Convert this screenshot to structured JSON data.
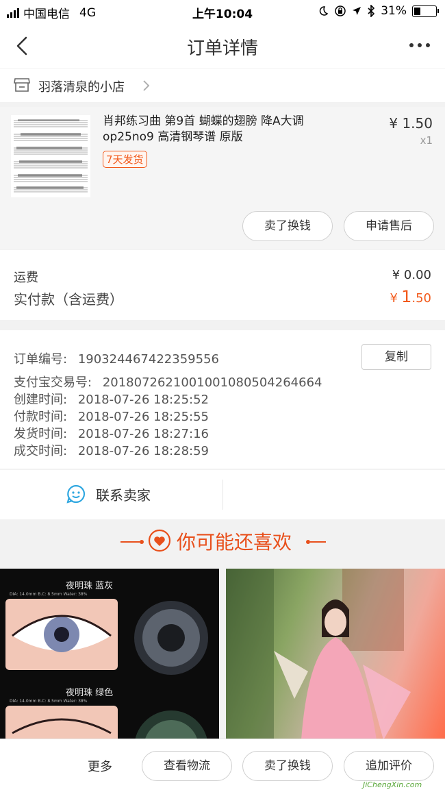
{
  "status_bar": {
    "carrier": "中国电信",
    "network": "4G",
    "time": "上午10:04",
    "battery": "31%",
    "battery_level": 0.31
  },
  "nav": {
    "title": "订单详情"
  },
  "shop": {
    "name": "羽落清泉的小店"
  },
  "product": {
    "title_line1": "肖邦练习曲 第9首 蝴蝶的翅膀 降A大调",
    "title_line2": "op25no9 高清钢琴谱 原版",
    "tag": "7天发货",
    "price": "¥ 1.50",
    "quantity": "x1",
    "sell_button": "卖了换钱",
    "after_sale_button": "申请售后"
  },
  "fees": {
    "shipping_label": "运费",
    "shipping_value": "¥ 0.00",
    "paid_label": "实付款（含运费）",
    "paid_currency": "¥",
    "paid_int": "1",
    "paid_dec": ".50"
  },
  "order_info": {
    "order_no_label": "订单编号:",
    "order_no": "190324467422359556",
    "copy_button": "复制",
    "alipay_label": "支付宝交易号:",
    "alipay_no": "2018072621001001080504264664",
    "created_label": "创建时间:",
    "created": "2018-07-26 18:25:52",
    "paid_label": "付款时间:",
    "paid": "2018-07-26 18:25:55",
    "shipped_label": "发货时间:",
    "shipped": "2018-07-26 18:27:16",
    "done_label": "成交时间:",
    "done": "2018-07-26 18:28:59"
  },
  "contact": {
    "label": "联系卖家"
  },
  "recommend": {
    "heading": "你可能还喜欢",
    "item1": {
      "title1": "夜明珠 蓝灰",
      "specs1": "DIA: 14.0mm  B.C: 8.5mm  Water: 38%",
      "title2": "夜明珠 绿色",
      "specs2": "DIA: 14.0mm  B.C: 8.5mm  Water: 38%"
    }
  },
  "bottom_bar": {
    "more": "更多",
    "logistics_button": "查看物流",
    "sell_button": "卖了换钱",
    "review_button": "追加评价"
  },
  "watermark": {
    "text": "JiChengXin.com"
  },
  "colors": {
    "accent": "#f25a1c",
    "link_blue": "#2fa7e0"
  }
}
